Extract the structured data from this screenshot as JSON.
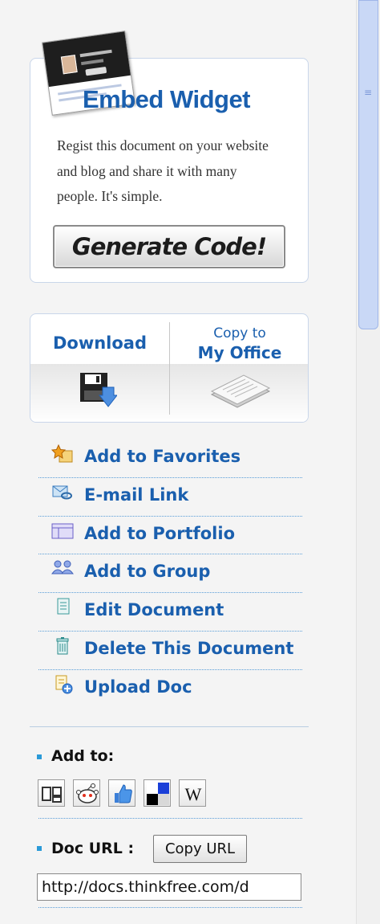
{
  "widget": {
    "title": "Embed Widget",
    "description": "Regist this document on your website and blog and share it with many people. It's simple.",
    "generate_button": "Generate Code!"
  },
  "download_panel": {
    "download_label": "Download",
    "copy_line1": "Copy to",
    "copy_line2": "My Office"
  },
  "actions": [
    {
      "label": "Add to Favorites",
      "icon": "favorites-star-icon"
    },
    {
      "label": "E-mail Link",
      "icon": "email-link-icon"
    },
    {
      "label": "Add to Portfolio",
      "icon": "portfolio-icon"
    },
    {
      "label": "Add to Group",
      "icon": "group-people-icon"
    },
    {
      "label": "Edit Document",
      "icon": "edit-document-icon"
    },
    {
      "label": "Delete This Document",
      "icon": "trash-icon"
    },
    {
      "label": "Upload Doc",
      "icon": "upload-doc-icon"
    }
  ],
  "add_to": {
    "label": "Add to:",
    "services": [
      "digg-icon",
      "reddit-icon",
      "thumbs-up-icon",
      "delicious-icon",
      "wikipedia-icon"
    ]
  },
  "doc_url": {
    "label": "Doc URL :",
    "copy_button": "Copy URL",
    "value": "http://docs.thinkfree.com/d"
  },
  "colors": {
    "link_blue": "#1a5fae",
    "bullet_blue": "#2a9ad8",
    "border": "#c9d6ea"
  }
}
